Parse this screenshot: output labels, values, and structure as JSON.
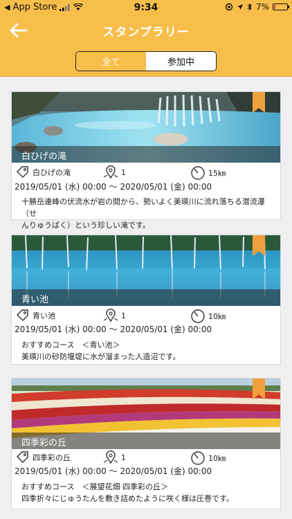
{
  "status_bar": {
    "carrier": "App Store",
    "time": "9:34",
    "battery": "7%"
  },
  "nav": {
    "title": "スタンプラリー"
  },
  "segments": {
    "all": "全て",
    "joined": "参加中"
  },
  "cards": [
    {
      "title": "白ひげの滝",
      "spot": "白ひげの滝",
      "count": "1",
      "distance": "15㎞",
      "dates": "2019/05/01 (水) 00:00 〜 2020/05/01 (金) 00:00",
      "desc1": "十勝岳連峰の伏流水が岩の間から、勢いよく美瑛川に流れ落ちる潜流瀑（せ",
      "desc2": "んりゅうばく）という珍しい滝です。"
    },
    {
      "title": "青い池",
      "spot": "青い池",
      "count": "1",
      "distance": "10㎞",
      "dates": "2019/05/01 (水) 00:00 〜 2020/05/01 (金) 00:00",
      "desc1": "おすすめコース　＜青い池＞",
      "desc2": "美瑛川の砂防堰堤に水が溜まった人造沼です。"
    },
    {
      "title": "四季彩の丘",
      "spot": "四季彩の丘",
      "count": "1",
      "distance": "10㎞",
      "dates": "2019/05/01 (水) 00:00 〜 2020/05/01 (金) 00:00",
      "desc1": "おすすめコース　＜展望花畑 四季彩の丘＞",
      "desc2": "四季折々にじゅうたんを敷き詰めたように咲く様は圧巻です。"
    }
  ],
  "colors": {
    "accent": "#f8be4a",
    "ribbon": "#f0a03a",
    "background": "#efeff2"
  }
}
